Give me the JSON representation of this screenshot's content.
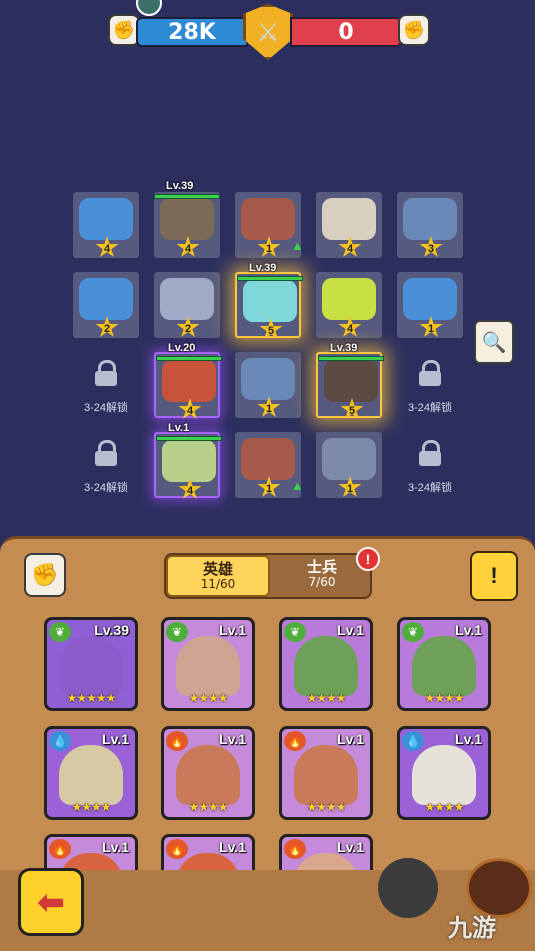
{
  "topbar": {
    "left_score": "28K",
    "right_score": "0",
    "left_icon": "fist-icon",
    "right_icon": "fist-icon",
    "center_icon": "crossed-swords-icon",
    "left_color": "#2f8ad6",
    "right_color": "#e0404c"
  },
  "battlefield": {
    "lock_text": "3-24解锁",
    "units": [
      {
        "star": "4",
        "level": "",
        "hp": false,
        "color": "#4b8fd8"
      },
      {
        "star": "4",
        "level": "Lv.39",
        "hp": true,
        "color": "#7b6a55"
      },
      {
        "star": "1",
        "level": "",
        "hp": false,
        "color": "#a55a4c",
        "arrow": true
      },
      {
        "star": "4",
        "level": "",
        "hp": false,
        "color": "#d8cfc0"
      },
      {
        "star": "3",
        "level": "",
        "hp": false,
        "color": "#6a88b8"
      },
      {
        "star": "2",
        "level": "",
        "hp": false,
        "color": "#4b8fd8"
      },
      {
        "star": "2",
        "level": "",
        "hp": false,
        "color": "#a0a9c6"
      },
      {
        "star": "5",
        "level": "Lv.39",
        "hp": true,
        "color": "#7fd7d9",
        "glow": true
      },
      {
        "star": "4",
        "level": "",
        "hp": false,
        "color": "#c8e044"
      },
      {
        "star": "1",
        "level": "",
        "hp": false,
        "color": "#4b8fd8"
      },
      {
        "star": "4",
        "level": "Lv.20",
        "hp": true,
        "color": "#c8523a",
        "purple": true
      },
      {
        "star": "1",
        "level": "",
        "hp": false,
        "color": "#6a88b8"
      },
      {
        "star": "5",
        "level": "Lv.39",
        "hp": true,
        "color": "#5b4a40",
        "glow": true
      },
      {
        "star": "4",
        "level": "Lv.1",
        "hp": true,
        "color": "#b9d08a",
        "purple": true
      },
      {
        "star": "1",
        "level": "",
        "hp": false,
        "color": "#a55a4c",
        "arrow": true
      },
      {
        "star": "1",
        "level": "",
        "hp": false,
        "color": "#7d8aa8"
      }
    ]
  },
  "panel": {
    "tab_hero_label": "英雄",
    "tab_hero_count": "11/60",
    "tab_soldier_label": "士兵",
    "tab_soldier_count": "7/60",
    "alert": "!",
    "menu_label": "!",
    "cards": [
      {
        "level": "Lv.39",
        "stars": "★★★★★",
        "elem": "leaf-icon",
        "elem_color": "#4fae3a",
        "bg": "#8e60d4",
        "face": "#8b5cc9"
      },
      {
        "level": "Lv.1",
        "stars": "★★★★",
        "elem": "leaf-icon",
        "elem_color": "#4fae3a",
        "bg": "#c58ad9",
        "face": "#cfa492"
      },
      {
        "level": "Lv.1",
        "stars": "★★★★",
        "elem": "leaf-icon",
        "elem_color": "#4fae3a",
        "bg": "#b97bd9",
        "face": "#6fa05a"
      },
      {
        "level": "Lv.1",
        "stars": "★★★★",
        "elem": "leaf-icon",
        "elem_color": "#4fae3a",
        "bg": "#b97bd9",
        "face": "#6fa05a"
      },
      {
        "level": "Lv.1",
        "stars": "★★★★",
        "elem": "water-icon",
        "elem_color": "#3a8fd8",
        "bg": "#9a62d6",
        "face": "#d7c9a4"
      },
      {
        "level": "Lv.1",
        "stars": "★★★★",
        "elem": "fire-icon",
        "elem_color": "#e2582a",
        "bg": "#c58ad9",
        "face": "#c87a5a"
      },
      {
        "level": "Lv.1",
        "stars": "★★★★",
        "elem": "fire-icon",
        "elem_color": "#e2582a",
        "bg": "#c58ad9",
        "face": "#c87a5a"
      },
      {
        "level": "Lv.1",
        "stars": "★★★★",
        "elem": "water-icon",
        "elem_color": "#3a8fd8",
        "bg": "#9a62d6",
        "face": "#e7e2d9"
      },
      {
        "level": "Lv.1",
        "stars": "★★★★",
        "elem": "fire-icon",
        "elem_color": "#e2582a",
        "bg": "#c58ad9",
        "face": "#d8653f"
      },
      {
        "level": "Lv.1",
        "stars": "★★★★",
        "elem": "fire-icon",
        "elem_color": "#e2582a",
        "bg": "#c58ad9",
        "face": "#d8653f"
      },
      {
        "level": "Lv.1",
        "stars": "★★★★",
        "elem": "fire-icon",
        "elem_color": "#e2582a",
        "bg": "#c58ad9",
        "face": "#d9a88c"
      }
    ]
  },
  "watermark": "九游"
}
